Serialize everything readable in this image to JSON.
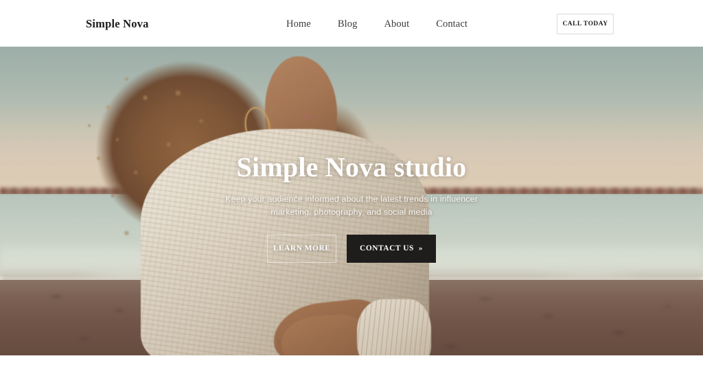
{
  "header": {
    "brand": "Simple Nova",
    "nav": [
      {
        "label": "Home"
      },
      {
        "label": "Blog"
      },
      {
        "label": "About"
      },
      {
        "label": "Contact"
      }
    ],
    "cta_label": "CALL TODAY"
  },
  "hero": {
    "title": "Simple Nova studio",
    "subtitle": "Keep your audience informed about the latest trends in influencer marketing, photography, and social media",
    "primary_button": "LEARN MORE",
    "secondary_button": "CONTACT US",
    "secondary_button_icon": "»",
    "image_alt": "Woman with curly hair in cream knit sweater on a beach at dusk"
  },
  "colors": {
    "page_background": "#ffffff",
    "header_background": "#ffffff",
    "brand_text": "#1d1b1a",
    "nav_text": "#3c3a38",
    "cta_border": "#dedad6",
    "hero_title": "#ffffff",
    "hero_subtitle": "#f7f5f2",
    "button_dark": "#1f1d1c",
    "sky_top": "#9cb2af",
    "sky_horizon": "#ded2c0",
    "water": "#cddacf",
    "sand": "#6b544a",
    "hair": "#7c5130",
    "sweater": "#e9e1d2",
    "skin": "#a5724e",
    "earring_gold": "#c9a060"
  }
}
